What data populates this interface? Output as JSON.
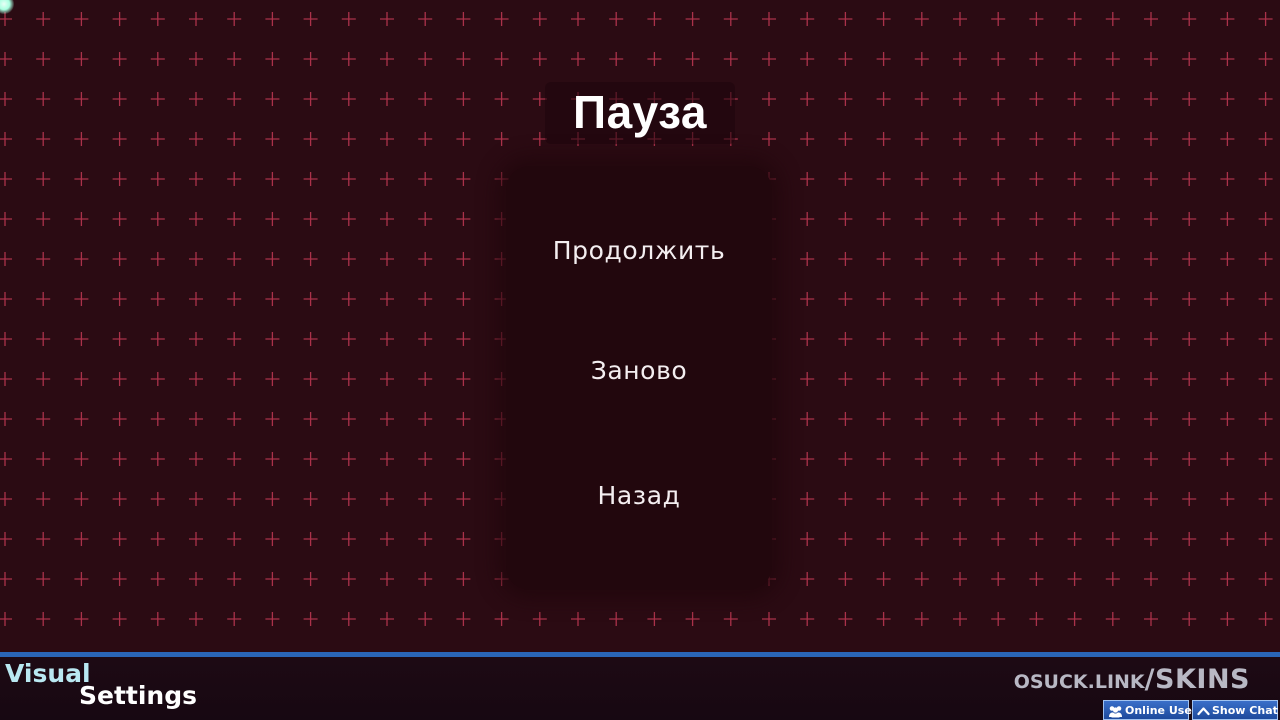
{
  "pause_menu": {
    "title": "Пауза",
    "items": [
      {
        "label": "Продолжить"
      },
      {
        "label": "Заново"
      },
      {
        "label": "Назад"
      }
    ]
  },
  "overlay": {
    "visual_settings_line1": "Visual",
    "visual_settings_line2": "Settings",
    "skin_link_prefix": "OSUCK.LINK",
    "skin_link_separator": "/",
    "skin_link_suffix": "SKINS",
    "online_users_label": "Online Users",
    "show_chat_label": "Show Chat"
  },
  "icons": {
    "online_users": "users-icon",
    "show_chat": "chevron-up-icon",
    "cursor": "cursor-glow-icon"
  },
  "colors": {
    "background": "#2b0b13",
    "grid_cross": "#c23a55",
    "panel": "#22070d",
    "accent_line": "#2a66b8"
  }
}
